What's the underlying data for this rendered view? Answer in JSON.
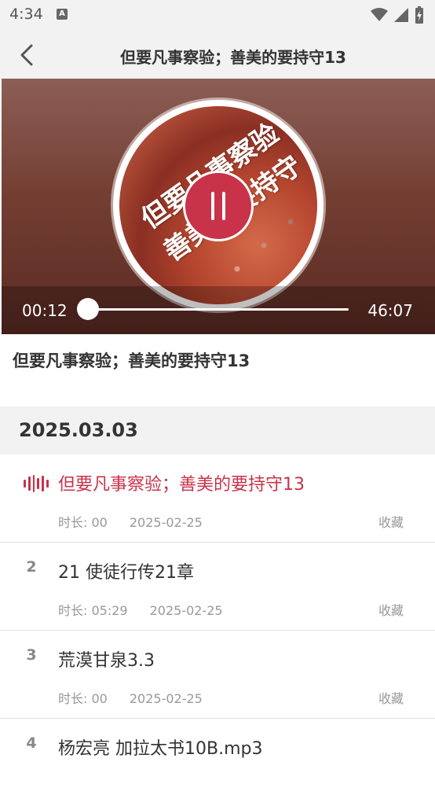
{
  "status_bar": {
    "time": "4:34",
    "notif_letter": "A"
  },
  "header": {
    "title": "但要凡事察验；善美的要持守13"
  },
  "player": {
    "cover_text_line1": "但要凡事察验",
    "cover_text_line2": "善美的要持守",
    "current_time": "00:12",
    "total_time": "46:07",
    "progress_fraction": 0.004,
    "accent_color": "#c8334a"
  },
  "now_playing": {
    "title": "但要凡事察验；善美的要持守13"
  },
  "date_section": {
    "date": "2025.03.03"
  },
  "list": {
    "items": [
      {
        "index": "",
        "title": "但要凡事察验；善美的要持守13",
        "duration": "时长: 00",
        "date": "2025-02-25",
        "fav": "收藏",
        "active": true
      },
      {
        "index": "2",
        "title": "21 使徒行传21章",
        "duration": "时长: 05:29",
        "date": "2025-02-25",
        "fav": "收藏",
        "active": false
      },
      {
        "index": "3",
        "title": "荒漠甘泉3.3",
        "duration": "时长: 00",
        "date": "2025-02-25",
        "fav": "收藏",
        "active": false
      },
      {
        "index": "4",
        "title": "杨宏亮 加拉太书10B.mp3",
        "duration": "",
        "date": "",
        "fav": "",
        "active": false
      }
    ]
  }
}
